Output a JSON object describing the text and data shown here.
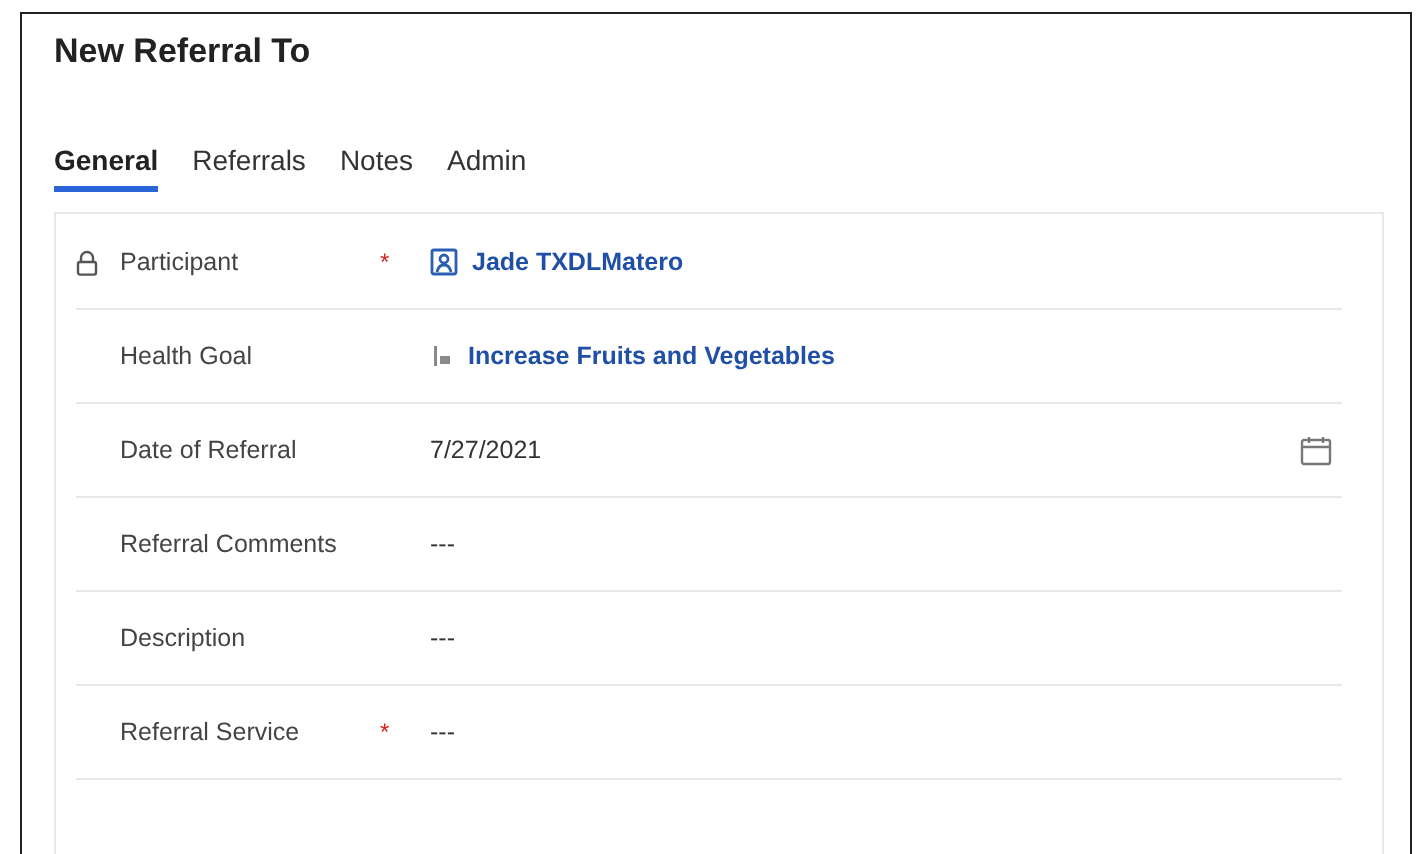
{
  "form": {
    "title": "New Referral To"
  },
  "tabs": [
    {
      "label": "General",
      "selected": true
    },
    {
      "label": "Referrals",
      "selected": false
    },
    {
      "label": "Notes",
      "selected": false
    },
    {
      "label": "Admin",
      "selected": false
    }
  ],
  "fields": [
    {
      "kind": "contact",
      "label": "Participant",
      "locked": true,
      "required_mark": "*",
      "value": "Jade TXDLMatero"
    },
    {
      "kind": "goal",
      "label": "Health Goal",
      "locked": false,
      "value": "Increase Fruits and Vegetables"
    },
    {
      "kind": "date",
      "label": "Date of Referral",
      "locked": false,
      "value": "7/27/2021"
    },
    {
      "kind": "text",
      "label": "Referral Comments",
      "locked": false,
      "value": "---"
    },
    {
      "kind": "text",
      "label": "Description",
      "locked": false,
      "value": "---"
    },
    {
      "kind": "text",
      "label": "Referral Service",
      "locked": false,
      "required_mark": "*",
      "value": "---"
    }
  ]
}
